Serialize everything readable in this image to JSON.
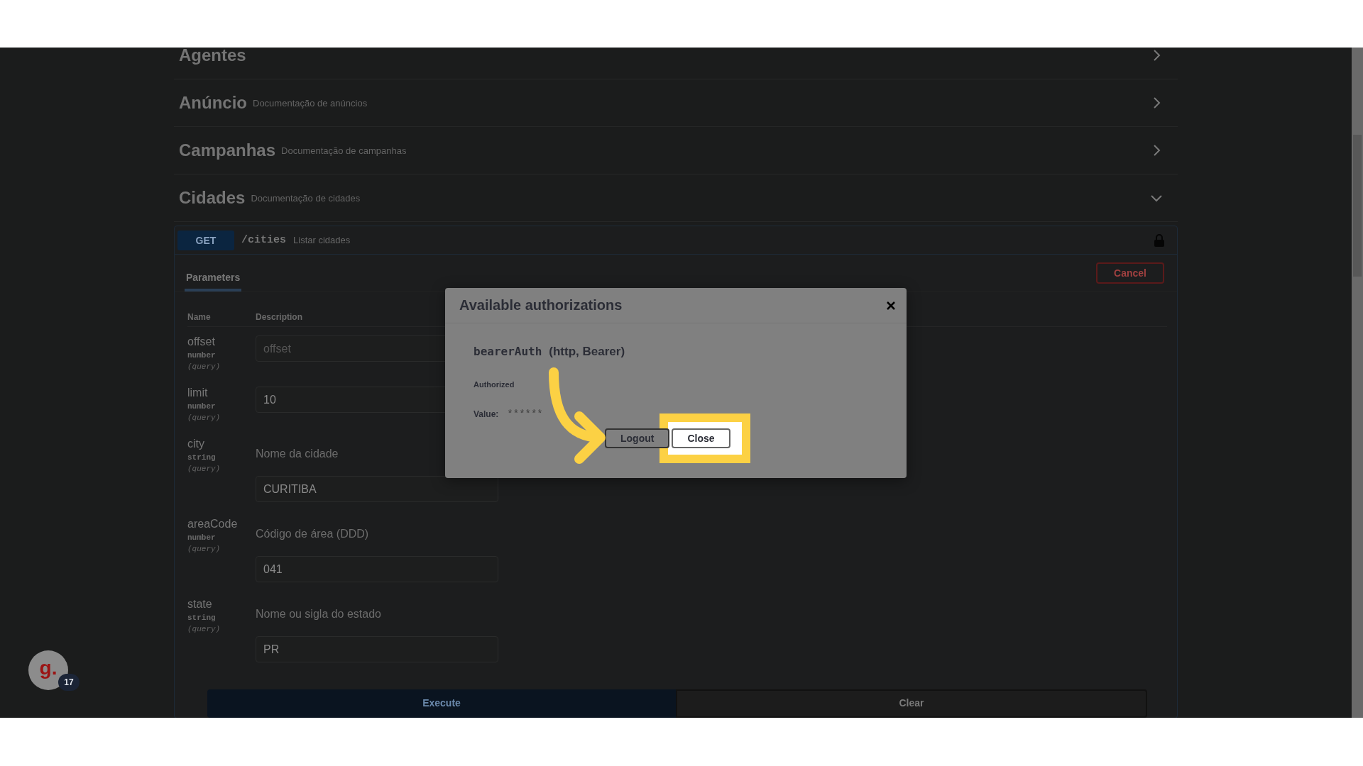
{
  "sections": [
    {
      "title": "Agentes",
      "expanded": false
    },
    {
      "title": "Anúncio",
      "description": "Documentação de anúncios",
      "expanded": false
    },
    {
      "title": "Campanhas",
      "description": "Documentação de campanhas",
      "expanded": false
    },
    {
      "title": "Cidades",
      "description": "Documentação de cidades",
      "expanded": true
    }
  ],
  "operation": {
    "method": "GET",
    "path": "/cities",
    "summary": "Listar cidades",
    "locked": true
  },
  "tabs": [
    {
      "label": "Parameters",
      "selected": true
    }
  ],
  "cancel_button": "Cancel",
  "columns": [
    "Name",
    "Description"
  ],
  "parameters": [
    {
      "name": "offset",
      "type": "number",
      "location": "(query)",
      "placeholder": "offset"
    },
    {
      "name": "limit",
      "type": "number",
      "location": "(query)",
      "value": "10"
    },
    {
      "name": "city",
      "type": "string",
      "location": "(query)",
      "description": "Nome da cidade",
      "value": "CURITIBA"
    },
    {
      "name": "areaCode",
      "type": "number",
      "location": "(query)",
      "description": "Código de área (DDD)",
      "value": "041"
    },
    {
      "name": "state",
      "type": "string",
      "location": "(query)",
      "description": "Nome ou sigla do estado",
      "value": "PR"
    }
  ],
  "actions": [
    "Execute",
    "Clear"
  ],
  "modal": {
    "title": "Available authorizations",
    "scheme_name": "bearerAuth",
    "scheme_type": "(http, Bearer)",
    "status": "Authorized",
    "value_label": "Value:",
    "value": "******",
    "buttons": [
      {
        "label": "Logout",
        "highlighted": false
      },
      {
        "label": "Close",
        "highlighted": true
      }
    ]
  },
  "avatar": {
    "logo": "g.",
    "badge": "17"
  }
}
